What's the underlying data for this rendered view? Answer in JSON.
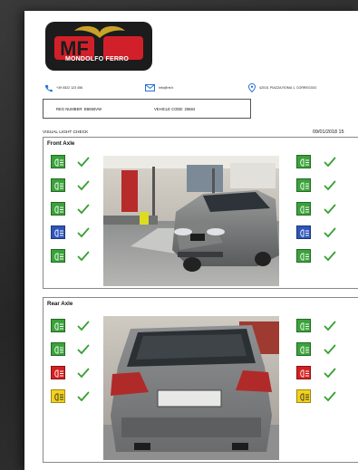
{
  "company": {
    "logo_letters": "MF",
    "name": "MONDOLFO FERRO"
  },
  "contacts": {
    "phone": "+39 0522 123 456",
    "email": "info@mf.it",
    "address": "42015, PIAZZA ROMA 1, CORREGGIO"
  },
  "vehicle": {
    "reg_label": "REG NUMBER: EB655VW",
    "code_label": "VEHICLE CODE: 25684"
  },
  "check": {
    "title": "VISUAL LIGHT CHECK",
    "datetime": "09/01/2018 15"
  },
  "colors": {
    "green": "#3aa23a",
    "blue": "#2f55b8",
    "red": "#d42020",
    "yellow": "#f3d21a",
    "check": "#36a030",
    "logo_red": "#d2202a",
    "logo_gold": "#c9a227"
  },
  "front_axle": {
    "title": "Front Axle",
    "left_lamps": [
      {
        "icon": "headlight-low-beam-icon",
        "color": "green",
        "status": "ok"
      },
      {
        "icon": "headlight-high-beam-icon",
        "color": "green",
        "status": "ok"
      },
      {
        "icon": "fog-light-icon",
        "color": "green",
        "status": "ok"
      },
      {
        "icon": "high-beam-blue-icon",
        "color": "blue",
        "status": "ok"
      },
      {
        "icon": "position-light-icon",
        "color": "green",
        "status": "ok"
      }
    ],
    "right_lamps": [
      {
        "icon": "headlight-low-beam-icon",
        "color": "green",
        "status": "ok"
      },
      {
        "icon": "headlight-high-beam-icon",
        "color": "green",
        "status": "ok"
      },
      {
        "icon": "fog-light-icon",
        "color": "green",
        "status": "ok"
      },
      {
        "icon": "high-beam-blue-icon",
        "color": "blue",
        "status": "ok"
      },
      {
        "icon": "position-light-icon",
        "color": "green",
        "status": "ok"
      }
    ]
  },
  "rear_axle": {
    "title": "Rear Axle",
    "left_lamps": [
      {
        "icon": "turn-signal-icon",
        "color": "green",
        "status": "ok"
      },
      {
        "icon": "position-light-icon",
        "color": "green",
        "status": "ok"
      },
      {
        "icon": "rear-fog-light-icon",
        "color": "red",
        "status": "ok"
      },
      {
        "icon": "reverse-light-icon",
        "color": "yellow",
        "status": "ok"
      }
    ],
    "right_lamps": [
      {
        "icon": "turn-signal-icon",
        "color": "green",
        "status": "ok"
      },
      {
        "icon": "position-light-icon",
        "color": "green",
        "status": "ok"
      },
      {
        "icon": "rear-fog-light-icon",
        "color": "red",
        "status": "ok"
      },
      {
        "icon": "reverse-light-icon",
        "color": "yellow",
        "status": "ok"
      }
    ]
  }
}
